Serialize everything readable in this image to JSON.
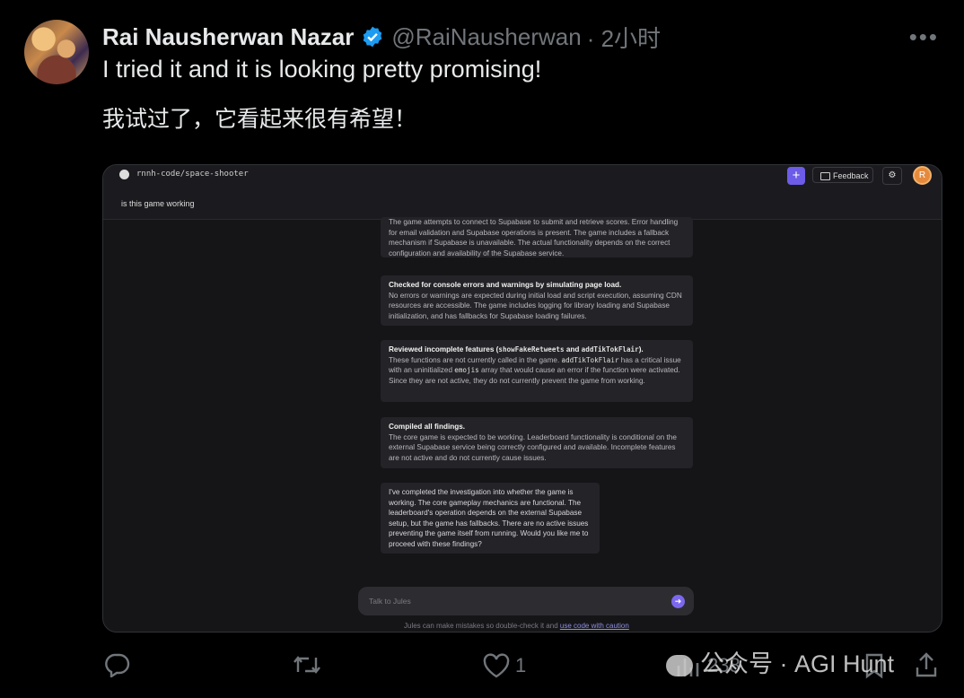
{
  "author": {
    "name": "Rai Nausherwan Nazar",
    "handle": "@RaiNausherwan",
    "time": "· 2小时"
  },
  "post": {
    "text_en": "I tried it and it is looking pretty promising!",
    "text_zh": "我试过了，它看起来很有希望！"
  },
  "screenshot": {
    "repo": "rnnh-code/space-shooter",
    "feedback_label": "Feedback",
    "user_initial": "R",
    "query": "is this game working",
    "cards": [
      {
        "body": "The game attempts to connect to Supabase to submit and retrieve scores. Error handling for email validation and Supabase operations is present. The game includes a fallback mechanism if Supabase is unavailable. The actual functionality depends on the correct configuration and availability of the Supabase service."
      },
      {
        "title": "Checked for console errors and warnings by simulating page load.",
        "body": "No errors or warnings are expected during initial load and script execution, assuming CDN resources are accessible. The game includes logging for library loading and Supabase initialization, and has fallbacks for Supabase loading failures."
      },
      {
        "title_pre": "Reviewed incomplete features (",
        "code1": "showFakeRetweets",
        "title_mid": " and ",
        "code2": "addTikTokFlair",
        "title_post": ").",
        "body_a": "These functions are not currently called in the game. ",
        "code3": "addTikTokFlair",
        "body_b": " has a critical issue with an uninitialized ",
        "code4": "emojis",
        "body_c": " array that would cause an error if the function were activated. Since they are not active, they do not currently prevent the game from working."
      },
      {
        "title": "Compiled all findings.",
        "body": "The core game is expected to be working. Leaderboard functionality is conditional on the external Supabase service being correctly configured and available. Incomplete features are not active and do not currently cause issues."
      }
    ],
    "final_message": "I've completed the investigation into whether the game is working. The core gameplay mechanics are functional. The leaderboard's operation depends on the external Supabase setup, but the game has fallbacks. There are no active issues preventing the game itself from running. Would you like me to proceed with these findings?",
    "input_placeholder": "Talk to Jules",
    "disclaimer_text": "Jules can make mistakes so double-check it and ",
    "disclaimer_link": "use code with caution"
  },
  "actions": {
    "likes": "1",
    "views": "238"
  },
  "watermark": {
    "text": "公众号 · AGI Hunt"
  },
  "colors": {
    "accent_purple": "#6c5ce7",
    "verified_blue": "#1d9bf0",
    "muted": "#71767b"
  }
}
